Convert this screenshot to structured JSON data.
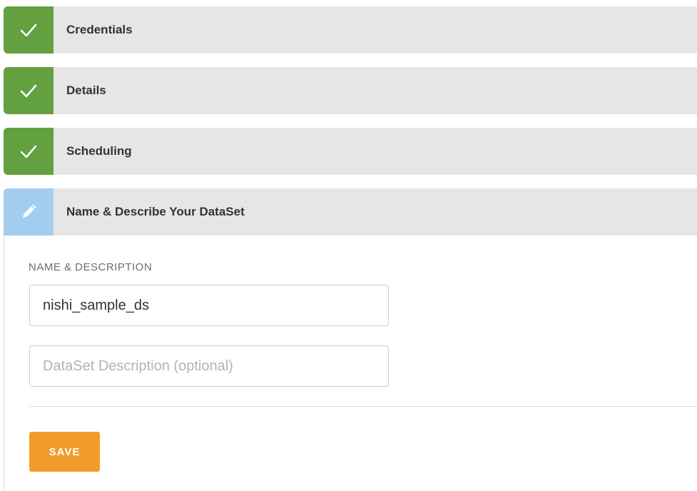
{
  "steps": [
    {
      "title": "Credentials",
      "status": "done",
      "icon": "check-icon"
    },
    {
      "title": "Details",
      "status": "done",
      "icon": "check-icon"
    },
    {
      "title": "Scheduling",
      "status": "done",
      "icon": "check-icon"
    },
    {
      "title": "Name & Describe Your DataSet",
      "status": "active",
      "icon": "pencil-icon"
    }
  ],
  "form": {
    "section_label": "NAME & DESCRIPTION",
    "name_value": "nishi_sample_ds",
    "description_placeholder": "DataSet Description (optional)",
    "save_label": "SAVE"
  },
  "colors": {
    "done": "#62a040",
    "active": "#a3cdf0",
    "step_bg": "#e6e6e6",
    "save": "#f29b2b"
  }
}
